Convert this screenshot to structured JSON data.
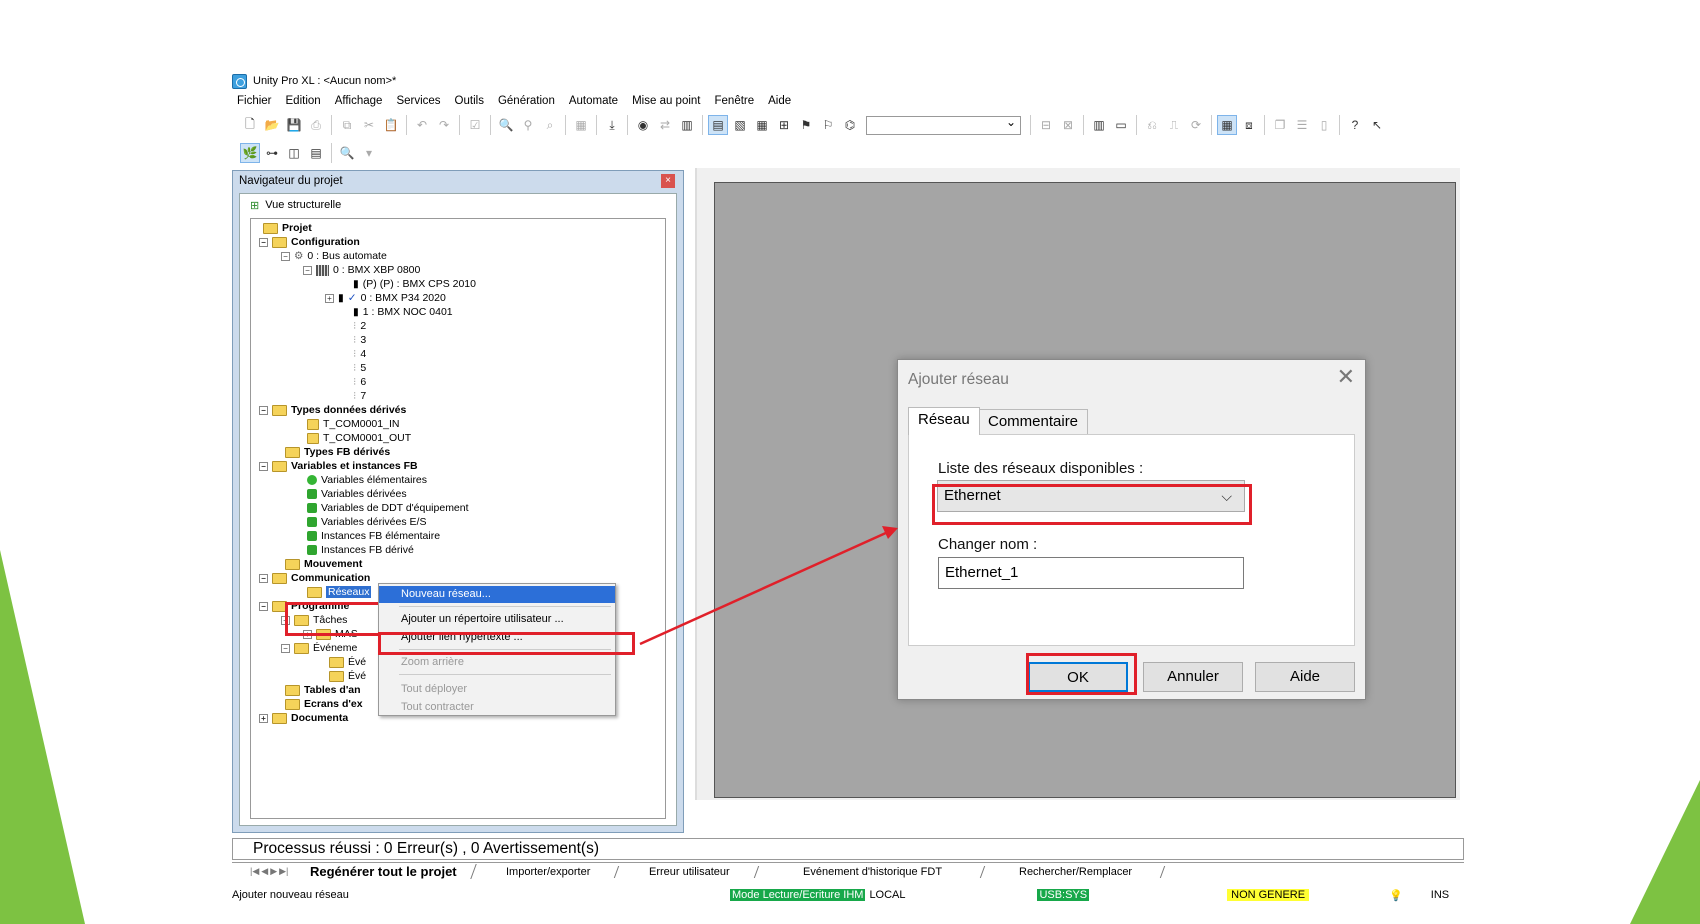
{
  "app": {
    "title": "Unity Pro XL : <Aucun nom>*",
    "menu": [
      "Fichier",
      "Edition",
      "Affichage",
      "Services",
      "Outils",
      "Génération",
      "Automate",
      "Mise au point",
      "Fenêtre",
      "Aide"
    ]
  },
  "navigator": {
    "title": "Navigateur du projet",
    "view_label": "Vue structurelle",
    "tree": {
      "projet": "Projet",
      "configuration": "Configuration",
      "bus": "0 : Bus automate",
      "rack": "0 : BMX XBP 0800",
      "cps": "(P) (P) : BMX CPS 2010",
      "cpu": "0 : BMX P34 2020",
      "noc": "1 : BMX NOC 0401",
      "slots": [
        "2",
        "3",
        "4",
        "5",
        "6",
        "7"
      ],
      "types_donnees": "Types données dérivés",
      "t_in": "T_COM0001_IN",
      "t_out": "T_COM0001_OUT",
      "types_fb": "Types FB dérivés",
      "variables": "Variables et instances FB",
      "var_items": [
        "Variables élémentaires",
        "Variables dérivées",
        "Variables de DDT d'équipement",
        "Variables dérivées E/S",
        "Instances FB élémentaire",
        "Instances FB dérivé"
      ],
      "mouvement": "Mouvement",
      "communication": "Communication",
      "reseaux": "Réseaux",
      "programme": "Programme",
      "taches": "Tâches",
      "mas": "MAS",
      "evenements": "Événeme",
      "eve1": "Évé",
      "eve2": "Évé",
      "tables": "Tables d'an",
      "ecrans": "Ecrans d'ex",
      "documentation": "Documenta"
    }
  },
  "context_menu": {
    "items": [
      "Nouveau réseau...",
      "Ajouter un répertoire utilisateur ...",
      "Ajouter lien hypertexte ...",
      "Zoom arrière",
      "Tout déployer",
      "Tout contracter"
    ]
  },
  "dialog": {
    "title": "Ajouter réseau",
    "tabs": [
      "Réseau",
      "Commentaire"
    ],
    "list_label": "Liste des réseaux disponibles :",
    "network_value": "Ethernet",
    "rename_label": "Changer nom :",
    "rename_value": "Ethernet_1",
    "ok": "OK",
    "cancel": "Annuler",
    "help": "Aide"
  },
  "output": {
    "message": "Processus réussi : 0 Erreur(s) , 0 Avertissement(s)",
    "tabs": [
      "Regénérer tout le projet",
      "Importer/exporter",
      "Erreur utilisateur",
      "Evénement d'historique FDT",
      "Rechercher/Remplacer"
    ]
  },
  "status": {
    "hint": "Ajouter nouveau réseau",
    "mode": "Mode Lecture/Ecriture IHM",
    "local": "LOCAL",
    "usb": "USB:SYS",
    "gen": "NON GENERE",
    "ins": "INS"
  },
  "colors": {
    "highlight": "#e0202a",
    "accent": "#2c6fd8",
    "green": "#7dc242"
  }
}
